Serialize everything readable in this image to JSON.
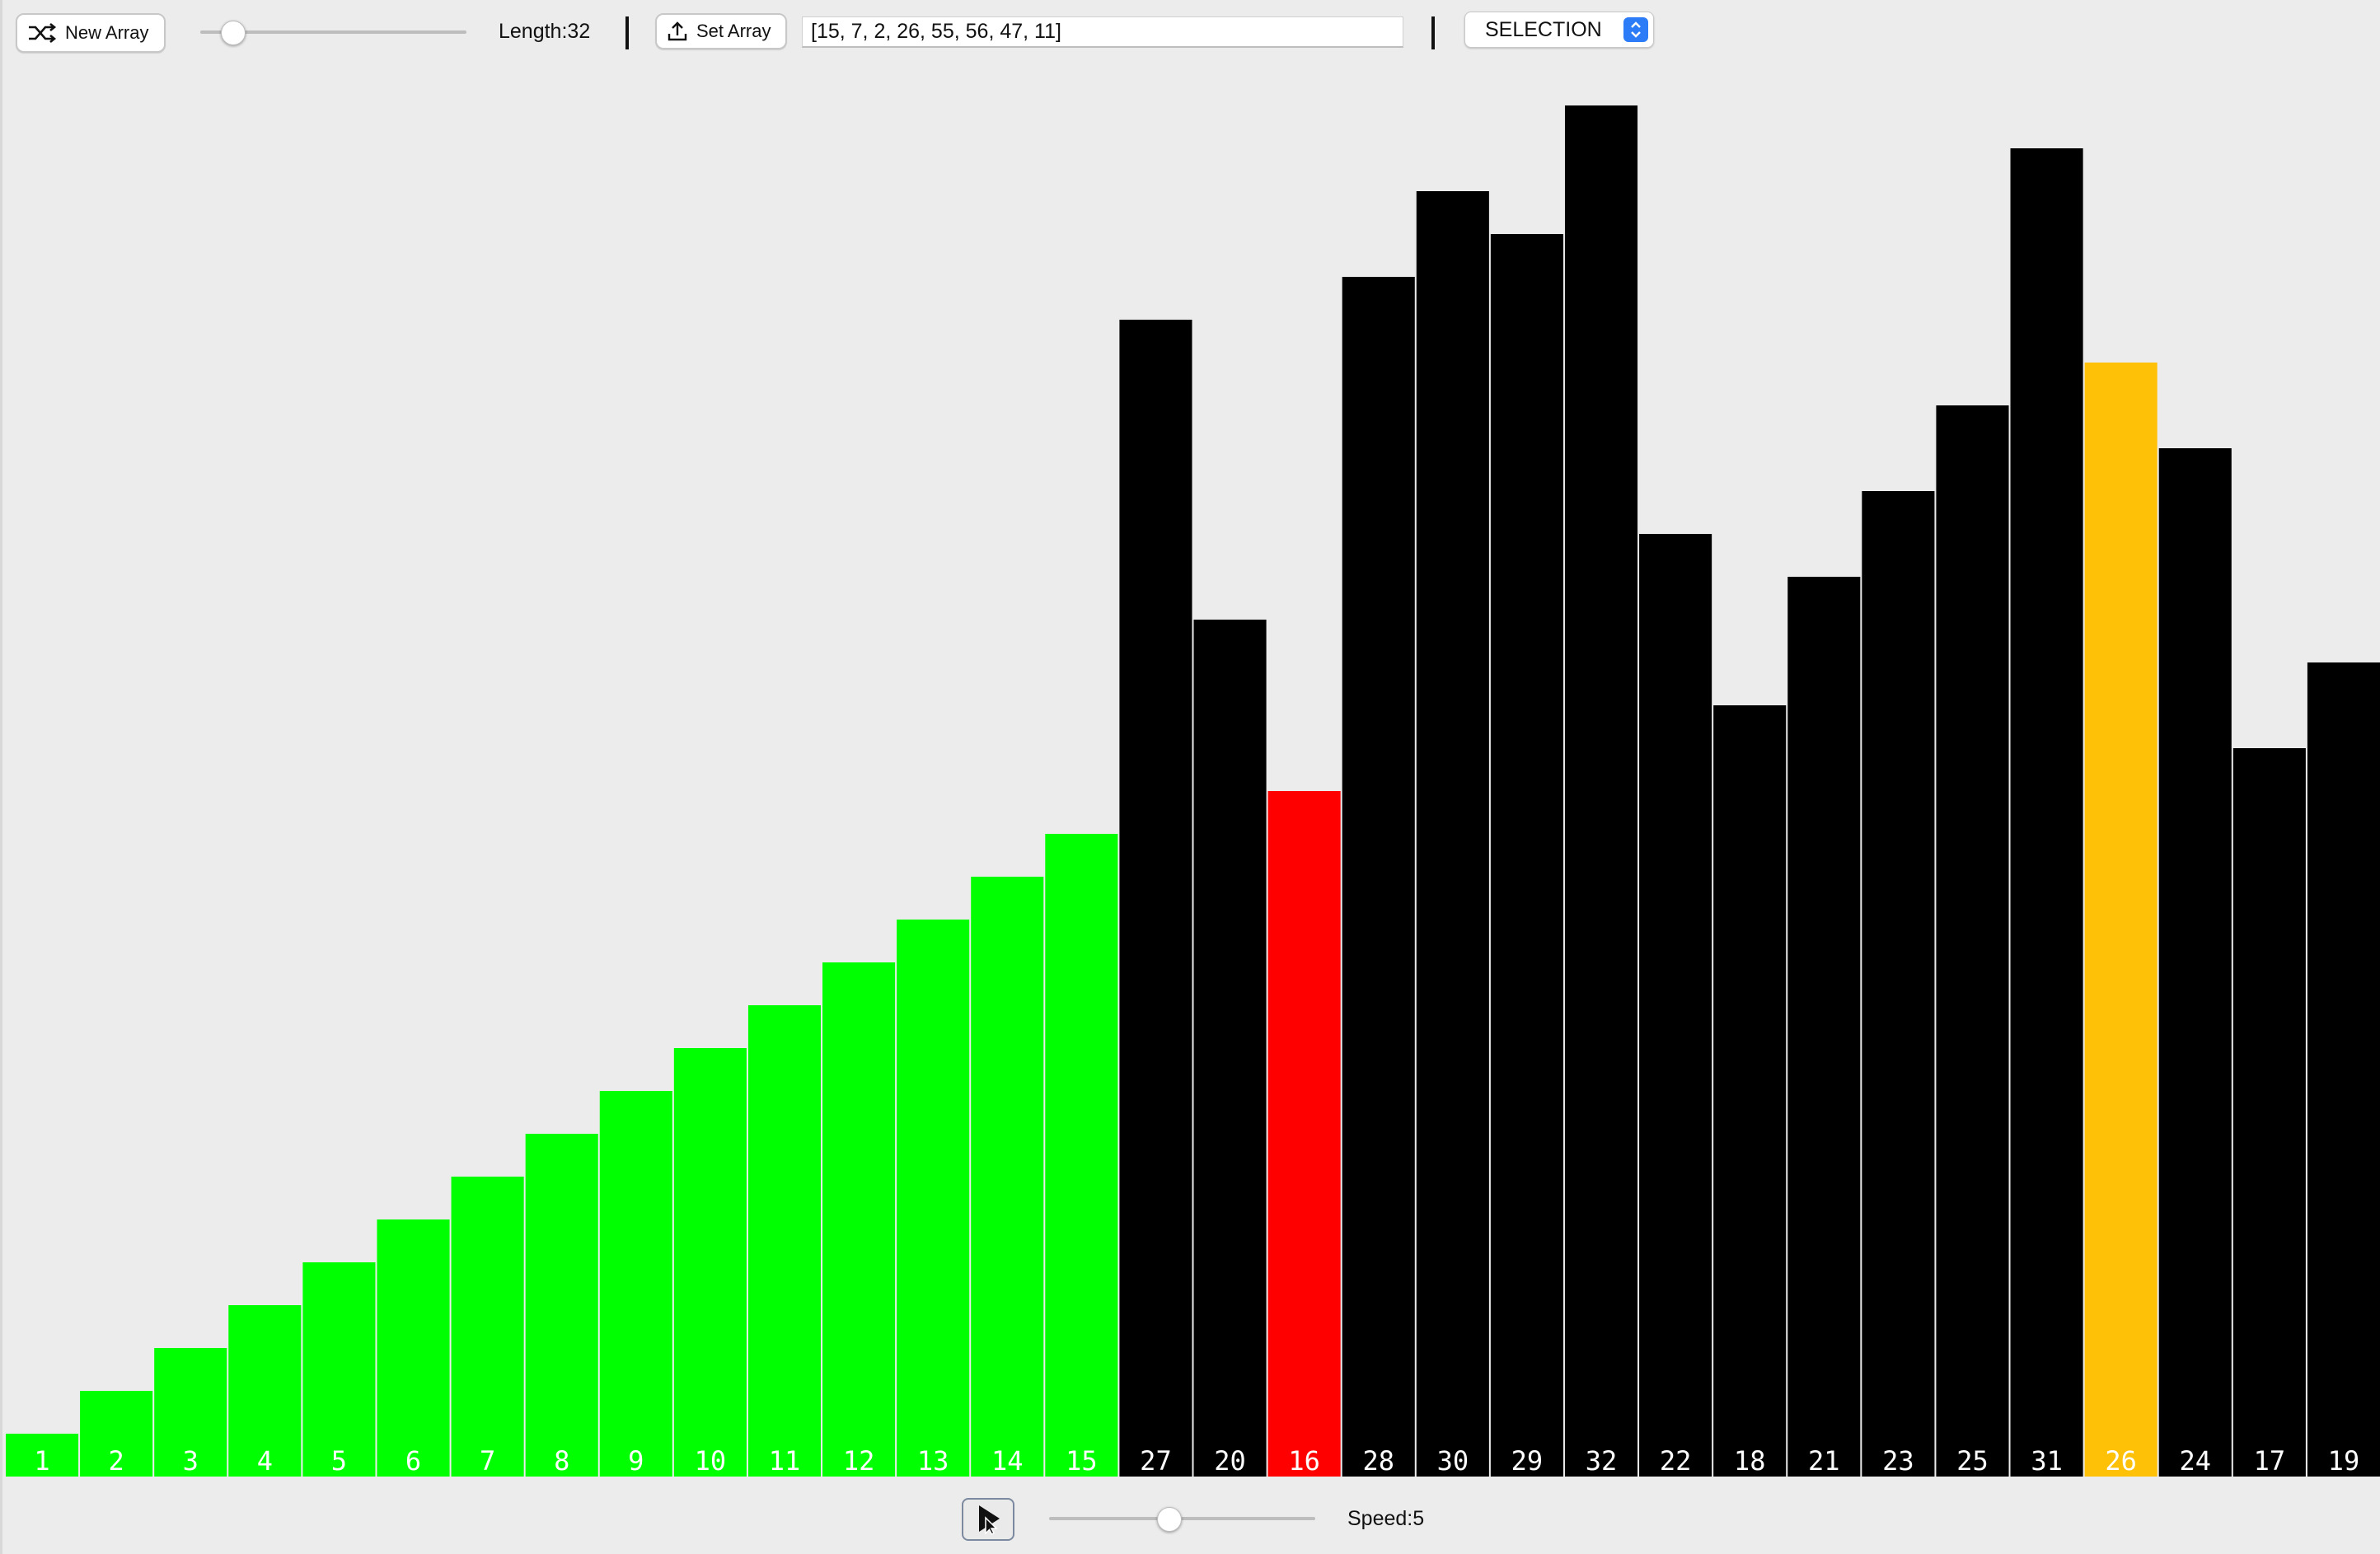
{
  "toolbar": {
    "new_array_label": "New Array",
    "length_label": "Length:32",
    "set_array_label": "Set Array",
    "array_input_value": "[15, 7, 2, 26, 55, 56, 47, 11]",
    "algorithm_selected": "SELECTION",
    "length_slider_fraction": 0.12
  },
  "bottom": {
    "speed_label": "Speed:5",
    "speed_slider_fraction": 0.45
  },
  "colors": {
    "sorted": "#00ff00",
    "unsorted": "#000000",
    "current": "#ff0000",
    "minimum": "#ffc107",
    "background": "#ececec",
    "label_text": "#ffffff"
  },
  "icons": {
    "new_array": "shuffle-icon",
    "set_array": "upload-icon",
    "select": "chevron-updown-icon",
    "play": "play-icon"
  },
  "chart_data": {
    "type": "bar",
    "values": [
      1,
      2,
      3,
      4,
      5,
      6,
      7,
      8,
      9,
      10,
      11,
      12,
      13,
      14,
      15,
      27,
      20,
      16,
      28,
      30,
      29,
      32,
      22,
      18,
      21,
      23,
      25,
      31,
      26,
      24,
      17,
      19
    ],
    "states": [
      "sorted",
      "sorted",
      "sorted",
      "sorted",
      "sorted",
      "sorted",
      "sorted",
      "sorted",
      "sorted",
      "sorted",
      "sorted",
      "sorted",
      "sorted",
      "sorted",
      "sorted",
      "unsorted",
      "unsorted",
      "current",
      "unsorted",
      "unsorted",
      "unsorted",
      "unsorted",
      "unsorted",
      "unsorted",
      "unsorted",
      "unsorted",
      "unsorted",
      "unsorted",
      "minimum",
      "unsorted",
      "unsorted",
      "unsorted"
    ],
    "ylim": [
      0,
      32
    ],
    "grid": false
  }
}
